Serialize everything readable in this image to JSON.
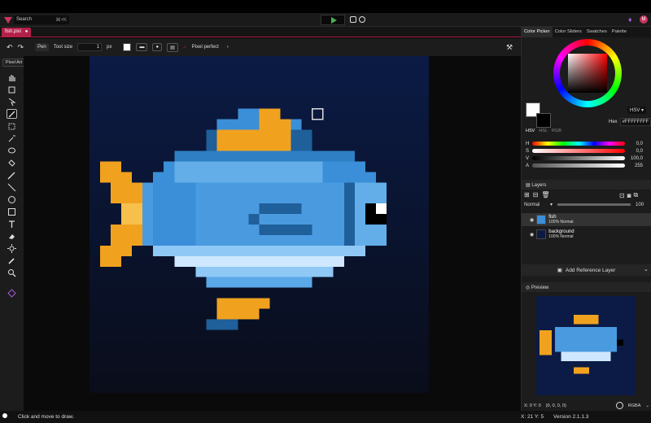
{
  "header": {
    "search_label": "Search",
    "search_shortcut": "⌘+K",
    "avatar_letter": "M"
  },
  "tab": {
    "name": "fish.pixi",
    "modified_mark": "●"
  },
  "tool_options": {
    "tool_name": "Pen",
    "size_label": "Tool size",
    "size_value": "1",
    "size_unit": "px",
    "pixel_perfect_label": "Pixel perfect"
  },
  "left": {
    "mode_label": "Pixel Art"
  },
  "right_tabs": [
    "Color Picker",
    "Color Sliders",
    "Swatches",
    "Palette"
  ],
  "color": {
    "mode": "HSV",
    "hex_label": "Hex",
    "hex_value": "#FFFFFFFF",
    "models": [
      "HSV",
      "HSL",
      "RGB"
    ],
    "sliders": [
      {
        "label": "H",
        "value": "0,0"
      },
      {
        "label": "S",
        "value": "0,0"
      },
      {
        "label": "V",
        "value": "100,0"
      },
      {
        "label": "A",
        "value": "255"
      }
    ]
  },
  "layers": {
    "title": "Layers",
    "blend": "Normal",
    "opacity": "100",
    "items": [
      {
        "name": "fish",
        "info": "100% Normal"
      },
      {
        "name": "background",
        "info": "100% Normal"
      }
    ],
    "add_reference": "Add Reference Layer"
  },
  "preview": {
    "title": "Preview",
    "coords": "X: 0 Y: 0",
    "rgba_value": "(0, 0, 0, 0)",
    "format": "RGBA"
  },
  "status": {
    "hint": "Click and move to draw.",
    "cursor": "X: 21 Y: 5",
    "version": "Version 2.1.1.3"
  },
  "colors": {
    "accent": "#b3214a",
    "bg_dark": "#0a1a3f",
    "fish_light": "#63aee8",
    "fish_mid": "#3b8fd8",
    "fish_dark": "#1f5f9a",
    "belly": "#cfe8ff",
    "fin_orange": "#f0a21f"
  }
}
